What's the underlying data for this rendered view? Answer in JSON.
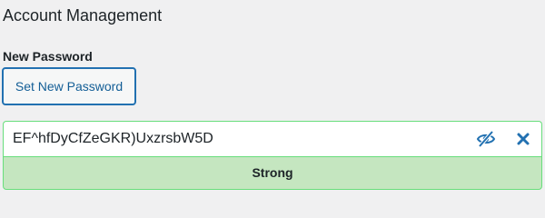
{
  "section": {
    "title": "Account Management"
  },
  "new_password": {
    "label": "New Password",
    "set_button_label": "Set New Password",
    "value": "EF^hfDyCfZeGKR)UxzrsbW5D",
    "strength_label": "Strong",
    "toggle_icon": "eye-slash-icon",
    "cancel_icon": "close-icon"
  },
  "colors": {
    "accent": "#2271b1",
    "strong_background": "#c5e6c0",
    "strong_border": "#68de7c"
  }
}
